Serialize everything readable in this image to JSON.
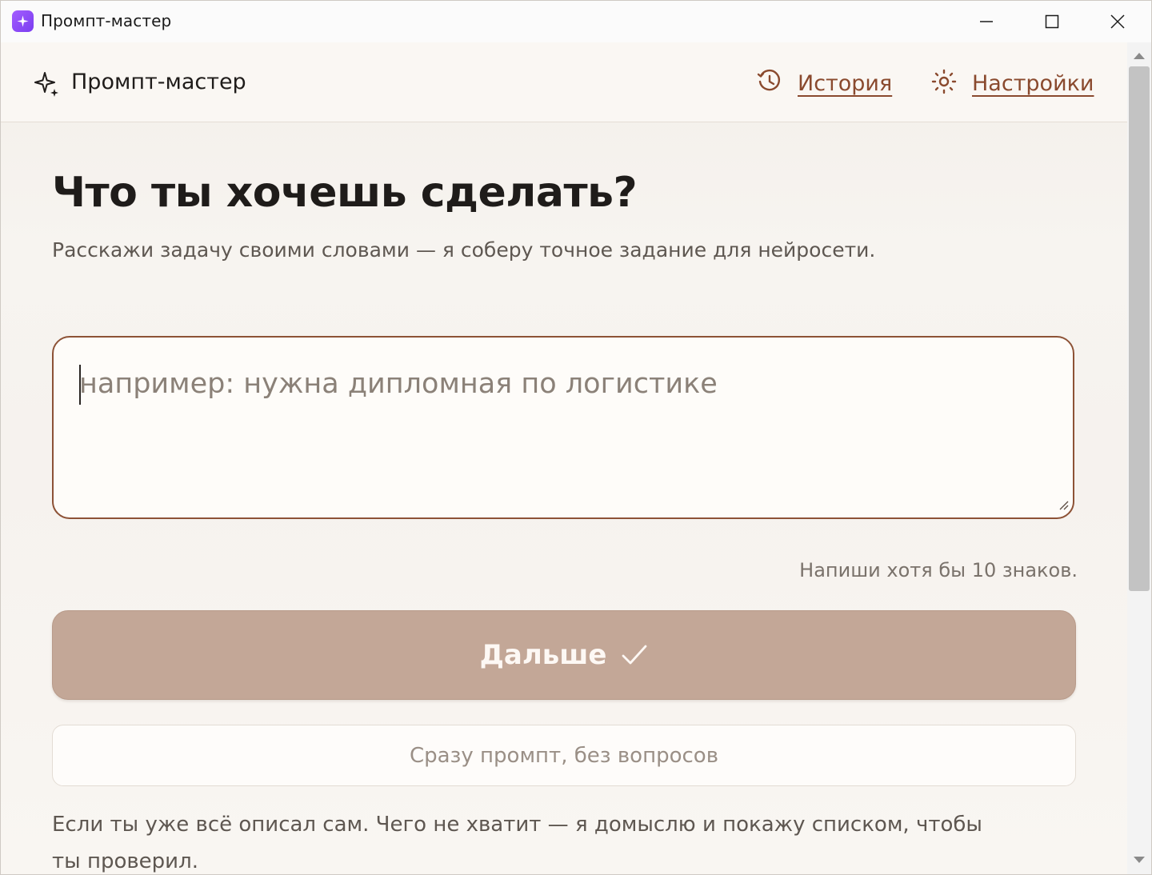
{
  "window": {
    "title": "Промпт-мастер"
  },
  "header": {
    "brand": "Промпт-мастер",
    "nav": {
      "history": "История",
      "settings": "Настройки"
    }
  },
  "main": {
    "heading": "Что ты хочешь сделать?",
    "subheading": "Расскажи задачу своими словами — я соберу точное задание для нейросети.",
    "task_input": {
      "value": "",
      "placeholder": "например: нужна дипломная по логистике"
    },
    "hint": "Напиши хотя бы 10 знаков.",
    "next_button": "Дальше",
    "quick_button": "Сразу промпт, без вопросов",
    "explain": "Если ты уже всё описал сам. Чего не хватит — я домыслю и покажу списком, чтобы ты проверил."
  },
  "icons": {
    "app": "sparkle-icon",
    "brand": "sparkle-icon",
    "history": "history-icon",
    "settings": "sun-icon",
    "next": "check-icon"
  },
  "colors": {
    "accent": "#8a4a2e",
    "button_disabled": "#c3a797",
    "input_border": "#8d5236"
  }
}
